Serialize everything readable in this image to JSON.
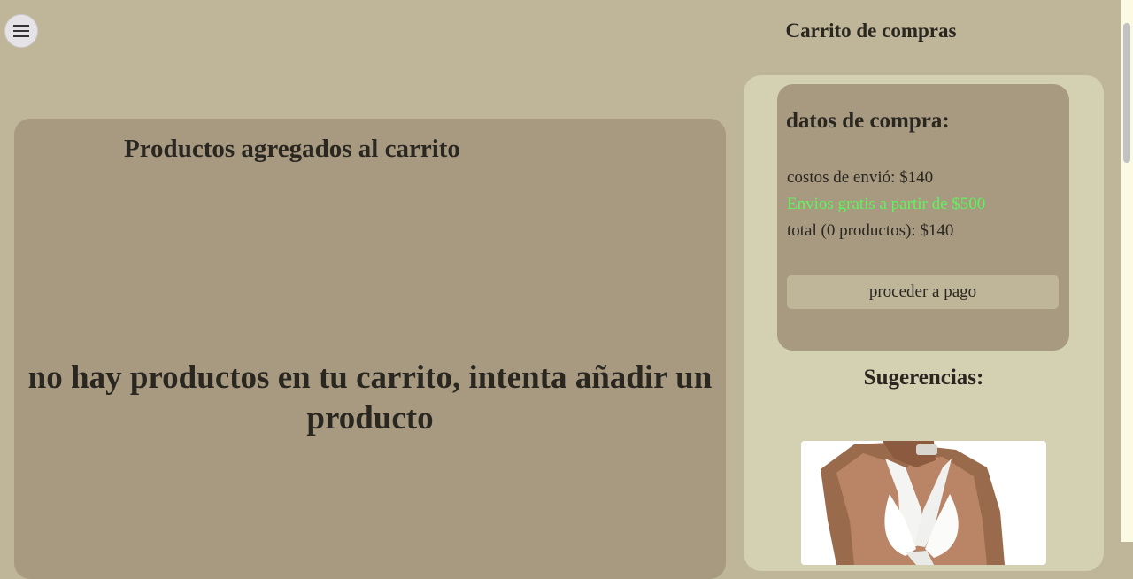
{
  "header": {
    "menu_icon": "hamburger-icon",
    "title": "Carrito de compras"
  },
  "cart": {
    "heading": "Productos agregados al carrito",
    "empty_message": "no hay productos en tu carrito, intenta añadir un producto"
  },
  "summary": {
    "title": "datos de compra:",
    "shipping": "costos de envió: $140",
    "free_shipping": "Envios gratis a partir de $500",
    "total": "total (0 productos): $140",
    "pay_label": "proceder a pago"
  },
  "suggestions": {
    "title": "Sugerencias:"
  },
  "colors": {
    "background": "#bfb699",
    "panel": "#a79a80",
    "sidebar": "#d4d0b2",
    "free_shipping_text": "#5ef55a"
  }
}
